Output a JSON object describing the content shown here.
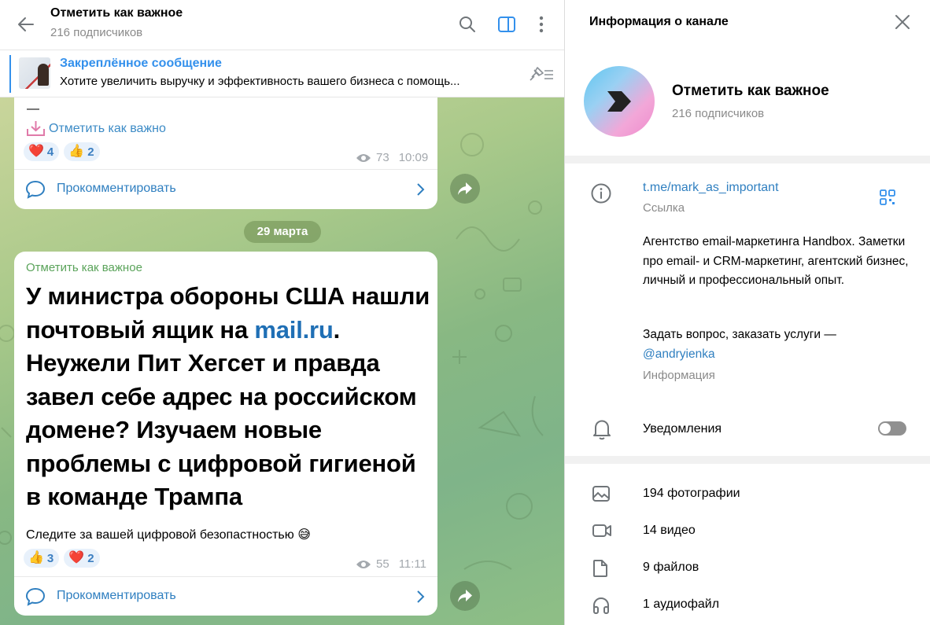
{
  "header": {
    "title": "Отметить как важное",
    "subtitle": "216 подписчиков"
  },
  "pinned": {
    "title": "Закреплённое сообщение",
    "text": "Хотите увеличить выручку и эффективность вашего бизнеса с помощь..."
  },
  "messages": [
    {
      "top_text": "—",
      "link_text": "Отметить как важно",
      "reactions": [
        {
          "emoji": "❤️",
          "count": "4"
        },
        {
          "emoji": "👍",
          "count": "2"
        }
      ],
      "views": "73",
      "time": "10:09",
      "comment_label": "Прокомментировать"
    },
    {
      "channel": "Отметить как важное",
      "headline_before": "У министра обороны США нашли почтовый ящик на ",
      "headline_link": "mail.ru",
      "headline_after": ". Неужели Пит Хегсет и правда завел себе адрес на российском домене? Изучаем новые проблемы с цифровой гигиеной в команде Трампа",
      "text": "Следите за вашей цифровой безопастностью 😅",
      "reactions": [
        {
          "emoji": "👍",
          "count": "3"
        },
        {
          "emoji": "❤️",
          "count": "2"
        }
      ],
      "views": "55",
      "time": "11:11",
      "comment_label": "Прокомментировать"
    }
  ],
  "date_divider": "29 марта",
  "panel": {
    "title": "Информация о канале",
    "name": "Отметить как важное",
    "subscribers": "216 подписчиков",
    "link": "t.me/mark_as_important",
    "link_label": "Ссылка",
    "about": "Агентство email-маркетинга Handbox. Заметки про email- и CRM-маркетинг, агентский бизнес, личный и профессиональный опыт.",
    "about_question": "Задать вопрос, заказать услуги —",
    "about_user": "@andryienka",
    "about_label": "Информация",
    "notifications_label": "Уведомления",
    "notifications_on": false,
    "media": [
      {
        "icon": "photo-icon",
        "label": "194 фотографии"
      },
      {
        "icon": "video-icon",
        "label": "14 видео"
      },
      {
        "icon": "file-icon",
        "label": "9 файлов"
      },
      {
        "icon": "headphones-icon",
        "label": "1 аудиофайл"
      }
    ]
  },
  "colors": {
    "accent": "#3390ec",
    "link": "#2f7fc0",
    "channel_name": "#5aa35a"
  }
}
